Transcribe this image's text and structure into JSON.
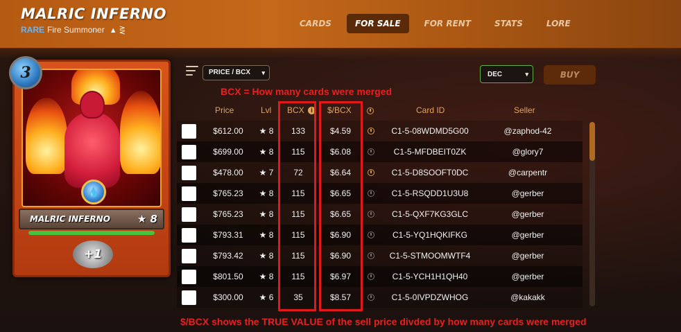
{
  "header": {
    "title": "MALRIC INFERNO",
    "rarity": "RARE",
    "subtitle": "Fire Summoner",
    "tabs": [
      {
        "label": "CARDS",
        "active": false
      },
      {
        "label": "FOR SALE",
        "active": true
      },
      {
        "label": "FOR RENT",
        "active": false
      },
      {
        "label": "STATS",
        "active": false
      },
      {
        "label": "LORE",
        "active": false
      }
    ]
  },
  "card": {
    "mana": "3",
    "name": "MALRIC INFERNO",
    "level": "★ 8",
    "stat": "+1",
    "xp_fraction": 1.0,
    "element_icon": "water-drop-icon"
  },
  "controls": {
    "sort_label": "PRICE / BCX",
    "direction_label": "DEC",
    "buy_label": "BUY"
  },
  "annotations": {
    "top": "BCX = How many cards were merged",
    "bottom": "$/BCX shows the TRUE VALUE of the sell price divded by how many cards were merged"
  },
  "table": {
    "columns": {
      "price": "Price",
      "lvl": "Lvl",
      "bcx": "BCX",
      "price_per_bcx": "$/BCX",
      "card_id": "Card ID",
      "seller": "Seller"
    },
    "rows": [
      {
        "price": "$612.00",
        "lvl": "★ 8",
        "bcx": "133",
        "ppb": "$4.59",
        "clock": "gold",
        "card_id": "C1-5-08WDMD5G00",
        "seller": "@zaphod-42"
      },
      {
        "price": "$699.00",
        "lvl": "★ 8",
        "bcx": "115",
        "ppb": "$6.08",
        "clock": "gray",
        "card_id": "C1-5-MFDBEIT0ZK",
        "seller": "@glory7"
      },
      {
        "price": "$478.00",
        "lvl": "★ 7",
        "bcx": "72",
        "ppb": "$6.64",
        "clock": "gold",
        "card_id": "C1-5-D8SOOFT0DC",
        "seller": "@carpentr"
      },
      {
        "price": "$765.23",
        "lvl": "★ 8",
        "bcx": "115",
        "ppb": "$6.65",
        "clock": "gray",
        "card_id": "C1-5-RSQDD1U3U8",
        "seller": "@gerber"
      },
      {
        "price": "$765.23",
        "lvl": "★ 8",
        "bcx": "115",
        "ppb": "$6.65",
        "clock": "gray",
        "card_id": "C1-5-QXF7KG3GLC",
        "seller": "@gerber"
      },
      {
        "price": "$793.31",
        "lvl": "★ 8",
        "bcx": "115",
        "ppb": "$6.90",
        "clock": "gray",
        "card_id": "C1-5-YQ1HQKIFKG",
        "seller": "@gerber"
      },
      {
        "price": "$793.42",
        "lvl": "★ 8",
        "bcx": "115",
        "ppb": "$6.90",
        "clock": "gray",
        "card_id": "C1-5-STMOOMWTF4",
        "seller": "@gerber"
      },
      {
        "price": "$801.50",
        "lvl": "★ 8",
        "bcx": "115",
        "ppb": "$6.97",
        "clock": "gray",
        "card_id": "C1-5-YCH1H1QH40",
        "seller": "@gerber"
      },
      {
        "price": "$300.00",
        "lvl": "★ 6",
        "bcx": "35",
        "ppb": "$8.57",
        "clock": "gray",
        "card_id": "C1-5-0IVPDZWHOG",
        "seller": "@kakakk"
      }
    ]
  },
  "colors": {
    "header": "#c4681a",
    "accent": "#e3a455",
    "annotation": "#e82020",
    "active_tab": "#5b2a08",
    "buy_button": "#5e2b0a"
  }
}
